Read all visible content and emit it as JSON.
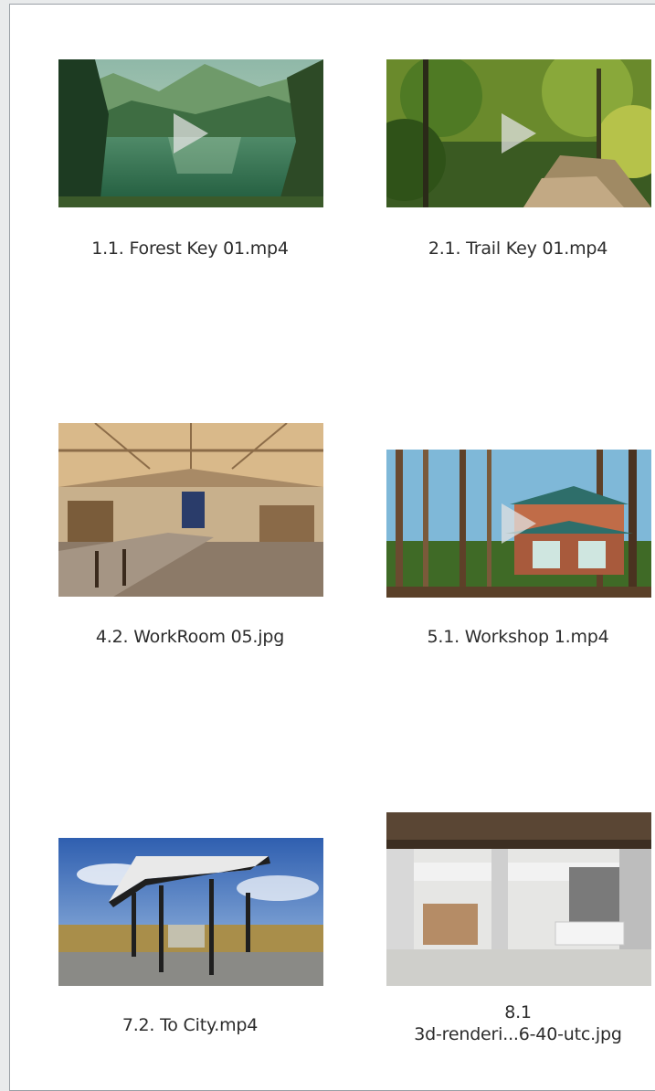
{
  "files": [
    {
      "name": "1.1. Forest Key 01.mp4",
      "icon": "lake-video-thumbnail-icon",
      "is_video": true
    },
    {
      "name": "2.1. Trail Key 01.mp4",
      "icon": "trail-video-thumbnail-icon",
      "is_video": true
    },
    {
      "name": "4.2. WorkRoom 05.jpg",
      "icon": "workroom-image-thumbnail-icon",
      "is_video": false
    },
    {
      "name": "5.1. Workshop 1.mp4",
      "icon": "workshop-video-thumbnail-icon",
      "is_video": true
    },
    {
      "name": "7.2. To City.mp4",
      "icon": "bus-stop-video-thumbnail-icon",
      "is_video": true
    },
    {
      "name_line1": "8.1",
      "name_line2": "3d-renderi...6-40-utc.jpg",
      "icon": "interior-render-image-thumbnail-icon",
      "is_video": false
    }
  ]
}
